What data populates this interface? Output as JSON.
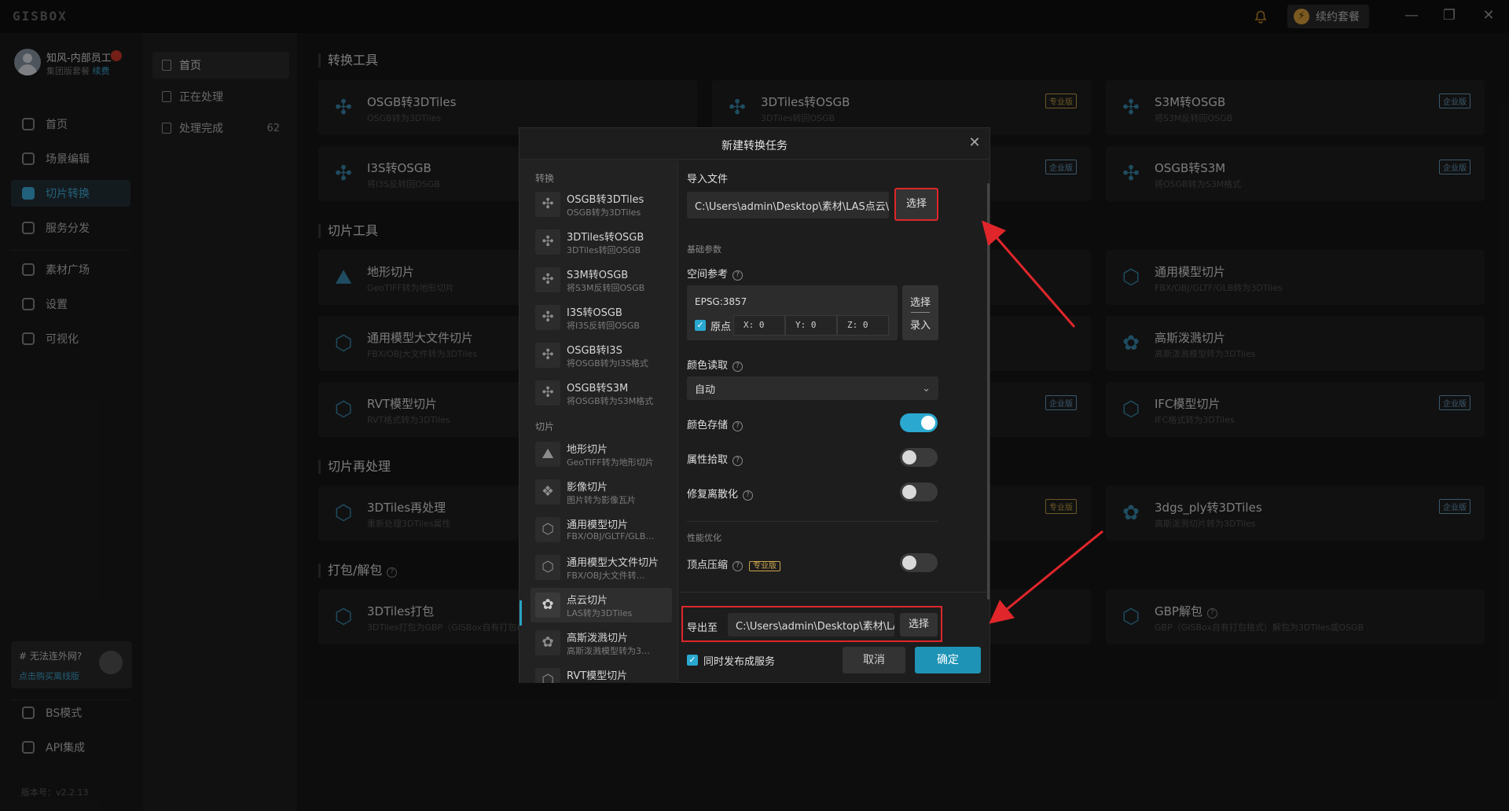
{
  "app": {
    "logo": "GISBOX",
    "renew_label": "续约套餐"
  },
  "user": {
    "name": "知风-内部员工",
    "plan": "集团版套餐",
    "renew_link": "续费"
  },
  "nav": {
    "items": [
      {
        "label": "首页"
      },
      {
        "label": "场景编辑"
      },
      {
        "label": "切片转换"
      },
      {
        "label": "服务分发"
      },
      {
        "label": "素材广场"
      },
      {
        "label": "设置"
      },
      {
        "label": "可视化"
      }
    ],
    "offline_title": "# 无法连外网?",
    "offline_link": "点击购买离线版",
    "bottom_items": [
      {
        "label": "BS模式"
      },
      {
        "label": "API集成"
      }
    ],
    "version": "版本号：v2.2.13"
  },
  "subnav": {
    "items": [
      {
        "label": "首页"
      },
      {
        "label": "正在处理"
      },
      {
        "label": "处理完成",
        "count": "62"
      }
    ]
  },
  "main": {
    "sections": [
      {
        "title": "转换工具"
      },
      {
        "title": "切片工具"
      },
      {
        "title": "切片再处理"
      },
      {
        "title": "打包/解包"
      }
    ],
    "cards": {
      "osgb_3dtiles": {
        "title": "OSGB转3DTiles",
        "sub": "OSGB转为3DTiles"
      },
      "3dtiles_osgb": {
        "title": "3DTiles转OSGB",
        "sub": "3DTiles转回OSGB",
        "badge": "专业版"
      },
      "s3m_osgb": {
        "title": "S3M转OSGB",
        "sub": "将S3M反转回OSGB",
        "badge": "企业版"
      },
      "i3s_osgb": {
        "title": "I3S转OSGB",
        "sub": "将I3S反转回OSGB"
      },
      "i3s_badge": {
        "badge": "企业版"
      },
      "osgb_s3m": {
        "title": "OSGB转S3M",
        "sub": "将OSGB转为S3M格式",
        "badge": "企业版"
      },
      "terrain": {
        "title": "地形切片",
        "sub": "GeoTIFF转为地形切片"
      },
      "generic_model": {
        "title": "通用模型切片",
        "sub": "FBX/OBJ/GLTF/GLB转为3DTiles"
      },
      "big_model": {
        "title": "通用模型大文件切片",
        "sub": "FBX/OBJ大文件转为3DTiles"
      },
      "gauss": {
        "title": "高斯泼溅切片",
        "sub": "高斯泼溅模型转为3DTiles"
      },
      "rvt": {
        "title": "RVT模型切片",
        "sub": "RVT格式转为3DTiles"
      },
      "rvt_badge": {
        "badge": "企业版"
      },
      "ifc": {
        "title": "IFC模型切片",
        "sub": "IFC格式转为3DTiles",
        "badge": "企业版"
      },
      "reprocess": {
        "title": "3DTiles再处理",
        "sub": "重新处理3DTiles属性"
      },
      "reprocess_badge": {
        "badge": "专业版"
      },
      "ply": {
        "title": "3dgs_ply转3DTiles",
        "sub": "高斯泼溅切片转为3DTiles",
        "badge": "企业版"
      },
      "pack": {
        "title": "3DTiles打包",
        "sub": "3DTiles打包为GBP（GISBox自有打包格式）"
      },
      "unpack": {
        "title": "GBP解包",
        "sub": "GBP（GISBox自有打包格式）解包为3DTiles或OSGB"
      }
    }
  },
  "modal": {
    "title": "新建转换任务",
    "left": {
      "group_convert": "转换",
      "group_slice": "切片",
      "items": [
        {
          "title": "OSGB转3DTiles",
          "sub": "OSGB转为3DTiles"
        },
        {
          "title": "3DTiles转OSGB",
          "sub": "3DTiles转回OSGB"
        },
        {
          "title": "S3M转OSGB",
          "sub": "将S3M反转回OSGB"
        },
        {
          "title": "I3S转OSGB",
          "sub": "将I3S反转回OSGB"
        },
        {
          "title": "OSGB转I3S",
          "sub": "将OSGB转为I3S格式"
        },
        {
          "title": "OSGB转S3M",
          "sub": "将OSGB转为S3M格式"
        },
        {
          "title": "地形切片",
          "sub": "GeoTIFF转为地形切片"
        },
        {
          "title": "影像切片",
          "sub": "图片转为影像瓦片"
        },
        {
          "title": "通用模型切片",
          "sub": "FBX/OBJ/GLTF/GLB…"
        },
        {
          "title": "通用模型大文件切片",
          "sub": "FBX/OBJ大文件转…"
        },
        {
          "title": "点云切片",
          "sub": "LAS转为3DTiles"
        },
        {
          "title": "高斯泼溅切片",
          "sub": "高斯泼溅模型转为3…"
        },
        {
          "title": "RVT模型切片",
          "sub": ""
        }
      ]
    },
    "import_label": "导入文件",
    "import_path": "C:\\Users\\admin\\Desktop\\素材\\LAS点云\\样例.las",
    "select_label": "选择",
    "basic_params": "基础参数",
    "spatial_ref_label": "空间参考",
    "epsg": "EPSG:3857",
    "origin_label": "原点",
    "coord_x": "X: 0",
    "coord_y": "Y: 0",
    "coord_z": "Z: 0",
    "select_top": "选择",
    "select_bottom": "录入",
    "color_read_label": "颜色读取",
    "color_read_value": "自动",
    "color_store_label": "颜色存储",
    "color_store_on": true,
    "attr_pick_label": "属性拾取",
    "attr_pick_on": false,
    "fix_discrete_label": "修复离散化",
    "fix_discrete_on": false,
    "perf_label": "性能优化",
    "vertex_compress_label": "顶点压缩",
    "vertex_compress_badge": "专业版",
    "vertex_compress_on": false,
    "export_label": "导出至",
    "export_path": "C:\\Users\\admin\\Desktop\\素材\\LAS点云…",
    "publish_label": "同时发布成服务",
    "cancel_label": "取消",
    "ok_label": "确定"
  },
  "colors": {
    "accent": "#2aa8d0",
    "highlight": "#e0262b",
    "pro_badge": "#c9a24a",
    "ent_badge": "#6aa3c9"
  }
}
